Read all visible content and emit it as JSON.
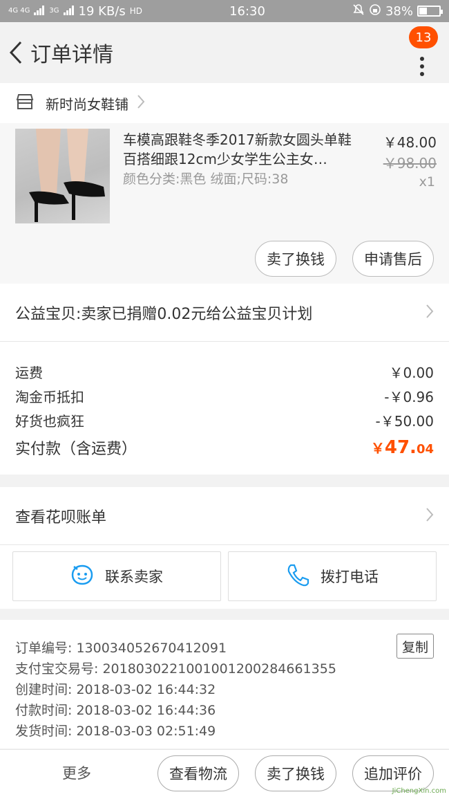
{
  "status_bar": {
    "network": "4G 4G",
    "network2": "3G",
    "speed": "19 KB/s",
    "hd": "HD",
    "time": "16:30",
    "battery": "38%"
  },
  "header": {
    "title": "订单详情",
    "badge_count": "13"
  },
  "shop": {
    "name": "新时尚女鞋铺"
  },
  "product": {
    "title": "车模高跟鞋冬季2017新款女圆头单鞋百搭细跟12cm少女学生公主女…",
    "sku": "颜色分类:黑色 绒面;尺码:38",
    "price_now": "￥48.00",
    "price_old": "￥98.00",
    "qty": "x1",
    "sell_label": "卖了换钱",
    "after_sale_label": "申请售后"
  },
  "charity": {
    "text": "公益宝贝:卖家已捐赠0.02元给公益宝贝计划"
  },
  "fees": {
    "shipping_label": "运费",
    "shipping_value": "￥0.00",
    "coins_label": "淘金币抵扣",
    "coins_value": "-￥0.96",
    "promo_label": "好货也疯狂",
    "promo_value": "-￥50.00",
    "total_label": "实付款（含运费）",
    "total_currency": "￥",
    "total_int": "47.",
    "total_dec": "04"
  },
  "huabei": {
    "text": "查看花呗账单"
  },
  "contact": {
    "seller_label": "联系卖家",
    "phone_label": "拨打电话"
  },
  "order_info": {
    "order_no": "订单编号: 130034052670412091",
    "alipay_no": "支付宝交易号: 2018030221001001200284661355",
    "created": "创建时间: 2018-03-02 16:44:32",
    "paid": "付款时间: 2018-03-02 16:44:36",
    "shipped": "发货时间: 2018-03-03 02:51:49",
    "copy_label": "复制"
  },
  "bottom_bar": {
    "more_label": "更多",
    "logistics_label": "查看物流",
    "sell_label": "卖了换钱",
    "review_label": "追加评价"
  },
  "watermark": {
    "text": "JiChengXin.com"
  },
  "colors": {
    "accent": "#ff5000",
    "contact_icon": "#1a9cf0"
  }
}
